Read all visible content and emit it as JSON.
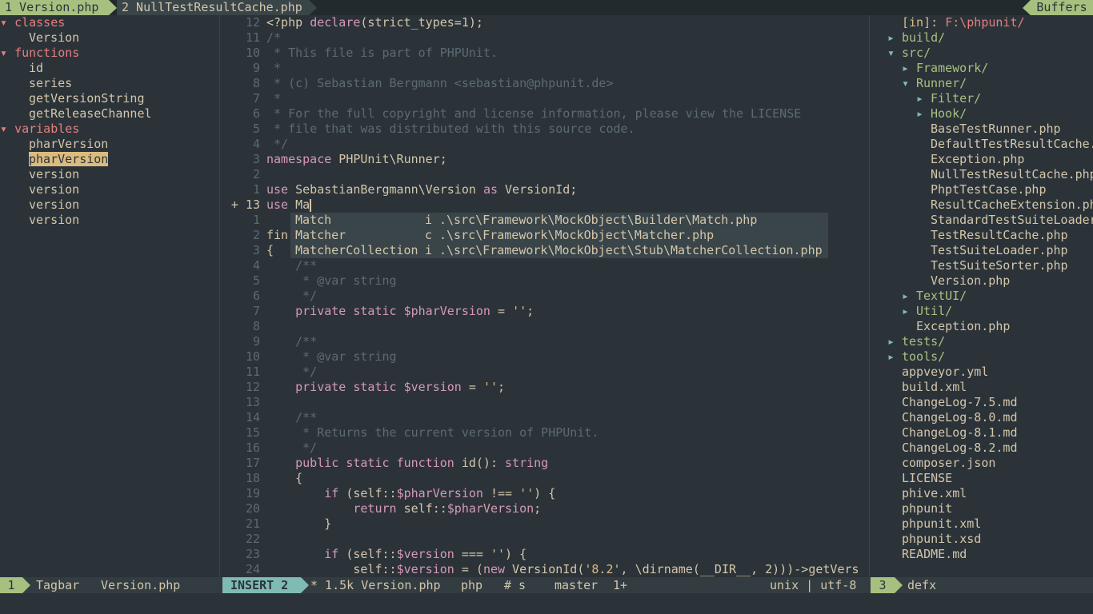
{
  "tabline": {
    "tab1_label": "1 Version.php",
    "tab2_label": "2 NullTestResultCache.php",
    "buffers_label": "Buffers"
  },
  "tagbar": {
    "groups": [
      {
        "kind": "classes",
        "items": [
          "Version"
        ]
      },
      {
        "kind": "functions",
        "items": [
          "id",
          "series",
          "getVersionString",
          "getReleaseChannel"
        ]
      },
      {
        "kind": "variables",
        "items": [
          "pharVersion",
          "pharVersion",
          "version",
          "version",
          "version",
          "version"
        ]
      }
    ],
    "selected_group": 2,
    "selected_index": 1
  },
  "editor": {
    "lines": [
      {
        "n": "12",
        "code": "<?php declare(strict_types=1);"
      },
      {
        "n": "11",
        "code": "/*"
      },
      {
        "n": "10",
        "code": " * This file is part of PHPUnit."
      },
      {
        "n": "9",
        "code": " *"
      },
      {
        "n": "8",
        "code": " * (c) Sebastian Bergmann <sebastian@phpunit.de>"
      },
      {
        "n": "7",
        "code": " *"
      },
      {
        "n": "6",
        "code": " * For the full copyright and license information, please view the LICENSE"
      },
      {
        "n": "5",
        "code": " * file that was distributed with this source code."
      },
      {
        "n": "4",
        "code": " */"
      },
      {
        "n": "3",
        "code": "namespace PHPUnit\\Runner;"
      },
      {
        "n": "2",
        "code": ""
      },
      {
        "n": "1",
        "code": "use SebastianBergmann\\Version as VersionId;"
      },
      {
        "n": "+ 13",
        "code": "use Ma"
      },
      {
        "n": "1",
        "code": ""
      },
      {
        "n": "2",
        "code": "fin"
      },
      {
        "n": "3",
        "code": "{"
      },
      {
        "n": "4",
        "code": "    /**"
      },
      {
        "n": "5",
        "code": "     * @var string"
      },
      {
        "n": "6",
        "code": "     */"
      },
      {
        "n": "7",
        "code": "    private static $pharVersion = '';"
      },
      {
        "n": "8",
        "code": ""
      },
      {
        "n": "9",
        "code": "    /**"
      },
      {
        "n": "10",
        "code": "     * @var string"
      },
      {
        "n": "11",
        "code": "     */"
      },
      {
        "n": "12",
        "code": "    private static $version = '';"
      },
      {
        "n": "13",
        "code": ""
      },
      {
        "n": "14",
        "code": "    /**"
      },
      {
        "n": "15",
        "code": "     * Returns the current version of PHPUnit."
      },
      {
        "n": "16",
        "code": "     */"
      },
      {
        "n": "17",
        "code": "    public static function id(): string"
      },
      {
        "n": "18",
        "code": "    {"
      },
      {
        "n": "19",
        "code": "        if (self::$pharVersion !== '') {"
      },
      {
        "n": "20",
        "code": "            return self::$pharVersion;"
      },
      {
        "n": "21",
        "code": "        }"
      },
      {
        "n": "22",
        "code": ""
      },
      {
        "n": "23",
        "code": "        if (self::$version === '') {"
      },
      {
        "n": "24",
        "code": "            self::$version = (new VersionId('8.2', \\dirname(__DIR__, 2)))->getVers"
      }
    ]
  },
  "completion": [
    {
      "word": "Match",
      "kind": "i",
      "path": ".\\src\\Framework\\MockObject\\Builder\\Match.php"
    },
    {
      "word": "Matcher",
      "kind": "c",
      "path": ".\\src\\Framework\\MockObject\\Matcher.php"
    },
    {
      "word": "MatcherCollection",
      "kind": "i",
      "path": ".\\src\\Framework\\MockObject\\Stub\\MatcherCollection.php"
    }
  ],
  "nerdtree": {
    "root_prefix": "[in]: ",
    "root_path": "F:\\phpunit/",
    "entries": [
      {
        "indent": 0,
        "arrow": "▸",
        "name": "build/",
        "type": "dir"
      },
      {
        "indent": 0,
        "arrow": "▾",
        "name": "src/",
        "type": "dir"
      },
      {
        "indent": 1,
        "arrow": "▸",
        "name": "Framework/",
        "type": "dir"
      },
      {
        "indent": 1,
        "arrow": "▾",
        "name": "Runner/",
        "type": "dir"
      },
      {
        "indent": 2,
        "arrow": "▸",
        "name": "Filter/",
        "type": "dir"
      },
      {
        "indent": 2,
        "arrow": "▸",
        "name": "Hook/",
        "type": "dir"
      },
      {
        "indent": 2,
        "arrow": "",
        "name": "BaseTestRunner.php",
        "type": "file"
      },
      {
        "indent": 2,
        "arrow": "",
        "name": "DefaultTestResultCache.",
        "type": "file"
      },
      {
        "indent": 2,
        "arrow": "",
        "name": "Exception.php",
        "type": "file"
      },
      {
        "indent": 2,
        "arrow": "",
        "name": "NullTestResultCache.php",
        "type": "file"
      },
      {
        "indent": 2,
        "arrow": "",
        "name": "PhptTestCase.php",
        "type": "file"
      },
      {
        "indent": 2,
        "arrow": "",
        "name": "ResultCacheExtension.ph",
        "type": "file"
      },
      {
        "indent": 2,
        "arrow": "",
        "name": "StandardTestSuiteLoader",
        "type": "file"
      },
      {
        "indent": 2,
        "arrow": "",
        "name": "TestResultCache.php",
        "type": "file"
      },
      {
        "indent": 2,
        "arrow": "",
        "name": "TestSuiteLoader.php",
        "type": "file"
      },
      {
        "indent": 2,
        "arrow": "",
        "name": "TestSuiteSorter.php",
        "type": "file"
      },
      {
        "indent": 2,
        "arrow": "",
        "name": "Version.php",
        "type": "file"
      },
      {
        "indent": 1,
        "arrow": "▸",
        "name": "TextUI/",
        "type": "dir"
      },
      {
        "indent": 1,
        "arrow": "▸",
        "name": "Util/",
        "type": "dir"
      },
      {
        "indent": 1,
        "arrow": "",
        "name": "Exception.php",
        "type": "file"
      },
      {
        "indent": 0,
        "arrow": "▸",
        "name": "tests/",
        "type": "dir"
      },
      {
        "indent": 0,
        "arrow": "▸",
        "name": "tools/",
        "type": "dir"
      },
      {
        "indent": 0,
        "arrow": "",
        "name": "appveyor.yml",
        "type": "file"
      },
      {
        "indent": 0,
        "arrow": "",
        "name": "build.xml",
        "type": "file"
      },
      {
        "indent": 0,
        "arrow": "",
        "name": "ChangeLog-7.5.md",
        "type": "file"
      },
      {
        "indent": 0,
        "arrow": "",
        "name": "ChangeLog-8.0.md",
        "type": "file"
      },
      {
        "indent": 0,
        "arrow": "",
        "name": "ChangeLog-8.1.md",
        "type": "file"
      },
      {
        "indent": 0,
        "arrow": "",
        "name": "ChangeLog-8.2.md",
        "type": "file"
      },
      {
        "indent": 0,
        "arrow": "",
        "name": "composer.json",
        "type": "file"
      },
      {
        "indent": 0,
        "arrow": "",
        "name": "LICENSE",
        "type": "file"
      },
      {
        "indent": 0,
        "arrow": "",
        "name": "phive.xml",
        "type": "file"
      },
      {
        "indent": 0,
        "arrow": "",
        "name": "phpunit",
        "type": "file"
      },
      {
        "indent": 0,
        "arrow": "",
        "name": "phpunit.xml",
        "type": "file"
      },
      {
        "indent": 0,
        "arrow": "",
        "name": "phpunit.xsd",
        "type": "file"
      },
      {
        "indent": 0,
        "arrow": "",
        "name": "README.md",
        "type": "file"
      }
    ]
  },
  "statusline": {
    "tagbar_num": "1",
    "tagbar_label": "Tagbar",
    "tagbar_file": "Version.php",
    "mode": "INSERT",
    "mode_num": "2",
    "file_info": "* 1.5k Version.php",
    "filetype": "php",
    "tag": "# s",
    "branch": "master",
    "changes": "1+",
    "format": "unix | utf-8",
    "nerd_num": "3",
    "nerd_label": "defx"
  },
  "colors": {
    "accent_green": "#a7c080",
    "accent_red": "#e67e80",
    "accent_yellow": "#dbbc7f",
    "accent_purple": "#d699b6",
    "accent_blue": "#7fbbb3",
    "background": "#2b3339"
  }
}
